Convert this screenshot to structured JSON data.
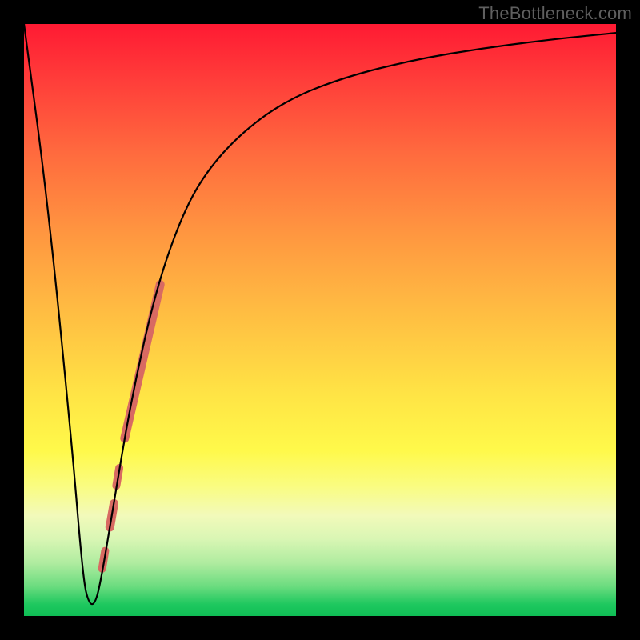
{
  "watermark": "TheBottleneck.com",
  "chart_data": {
    "type": "line",
    "title": "",
    "xlabel": "",
    "ylabel": "",
    "xlim": [
      0,
      100
    ],
    "ylim": [
      0,
      100
    ],
    "grid": false,
    "legend": false,
    "series": [
      {
        "name": "bottleneck-curve",
        "color": "#000000",
        "x": [
          0,
          4,
          8,
          10,
          11,
          12,
          13,
          15,
          18,
          22,
          26,
          30,
          36,
          44,
          54,
          66,
          78,
          90,
          100
        ],
        "y": [
          100,
          70,
          30,
          6,
          2,
          2,
          6,
          18,
          36,
          54,
          66,
          74,
          81,
          87,
          91,
          94,
          96,
          97.5,
          98.5
        ]
      }
    ],
    "highlight_segments": [
      {
        "name": "seg-long",
        "x": [
          17.0,
          23.0
        ],
        "y": [
          30.0,
          56.0
        ],
        "width": 11
      },
      {
        "name": "seg-dot1",
        "x": [
          15.6,
          16.1
        ],
        "y": [
          22.0,
          25.0
        ],
        "width": 10
      },
      {
        "name": "seg-dot2",
        "x": [
          14.5,
          15.2
        ],
        "y": [
          15.0,
          19.0
        ],
        "width": 11
      },
      {
        "name": "seg-dot3",
        "x": [
          13.2,
          13.7
        ],
        "y": [
          8.0,
          11.0
        ],
        "width": 10
      }
    ],
    "highlight_color": "#d86a62"
  }
}
